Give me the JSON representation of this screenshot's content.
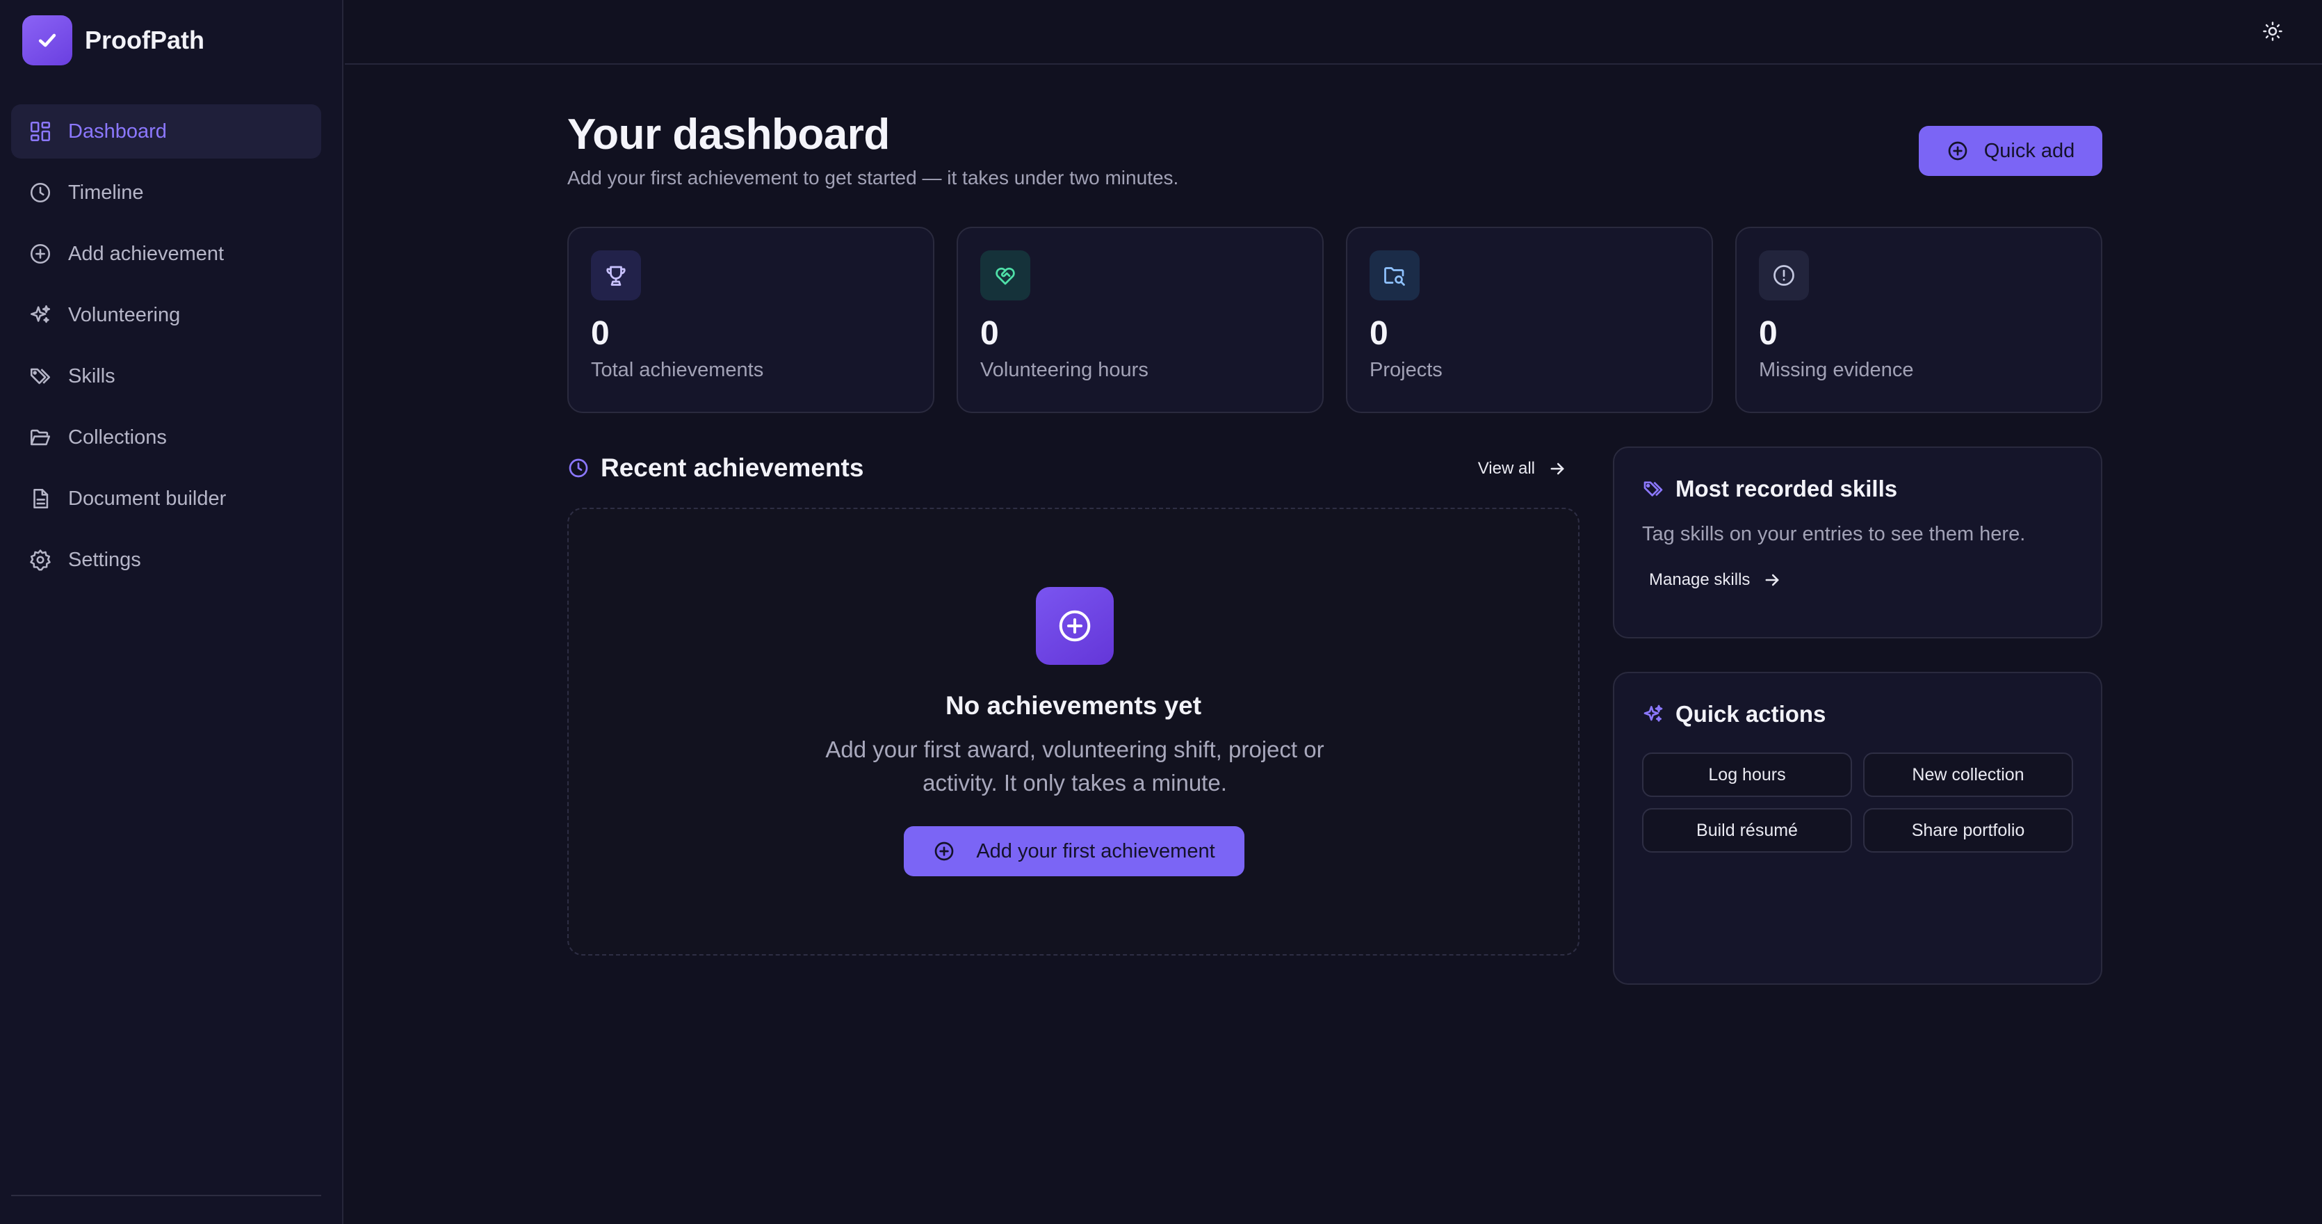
{
  "app": {
    "name": "ProofPath"
  },
  "colors": {
    "accent": "#7b65f5",
    "background": "#111120",
    "sidebar": "#131326",
    "card": "#15152a"
  },
  "sidebar": {
    "items": [
      {
        "label": "Dashboard",
        "icon": "dashboard-grid-icon",
        "active": true
      },
      {
        "label": "Timeline",
        "icon": "clock-icon"
      },
      {
        "label": "Add achievement",
        "icon": "plus-circle-icon"
      },
      {
        "label": "Volunteering",
        "icon": "sparkles-icon"
      },
      {
        "label": "Skills",
        "icon": "tags-icon"
      },
      {
        "label": "Collections",
        "icon": "folder-open-icon"
      },
      {
        "label": "Document builder",
        "icon": "document-icon"
      },
      {
        "label": "Settings",
        "icon": "gear-icon"
      }
    ]
  },
  "topbar": {
    "theme_toggle_icon": "sun-icon"
  },
  "header": {
    "title": "Your dashboard",
    "subtitle": "Add your first achievement to get started — it takes under two minutes.",
    "quick_add_label": "Quick add"
  },
  "stats": [
    {
      "value": "0",
      "label": "Total achievements",
      "icon": "trophy-icon"
    },
    {
      "value": "0",
      "label": "Volunteering hours",
      "icon": "heart-handshake-icon"
    },
    {
      "value": "0",
      "label": "Projects",
      "icon": "folder-search-icon"
    },
    {
      "value": "0",
      "label": "Missing evidence",
      "icon": "alert-circle-icon"
    }
  ],
  "recent": {
    "title": "Recent achievements",
    "view_all_label": "View all",
    "empty_title": "No achievements yet",
    "empty_description": "Add your first award, volunteering shift, project or activity. It only takes a minute.",
    "empty_button_label": "Add your first achievement"
  },
  "skills_panel": {
    "title": "Most recorded skills",
    "description": "Tag skills on your entries to see them here.",
    "manage_label": "Manage skills"
  },
  "quick_actions": {
    "title": "Quick actions",
    "buttons": [
      "Log hours",
      "New collection",
      "Build résumé",
      "Share portfolio"
    ]
  }
}
